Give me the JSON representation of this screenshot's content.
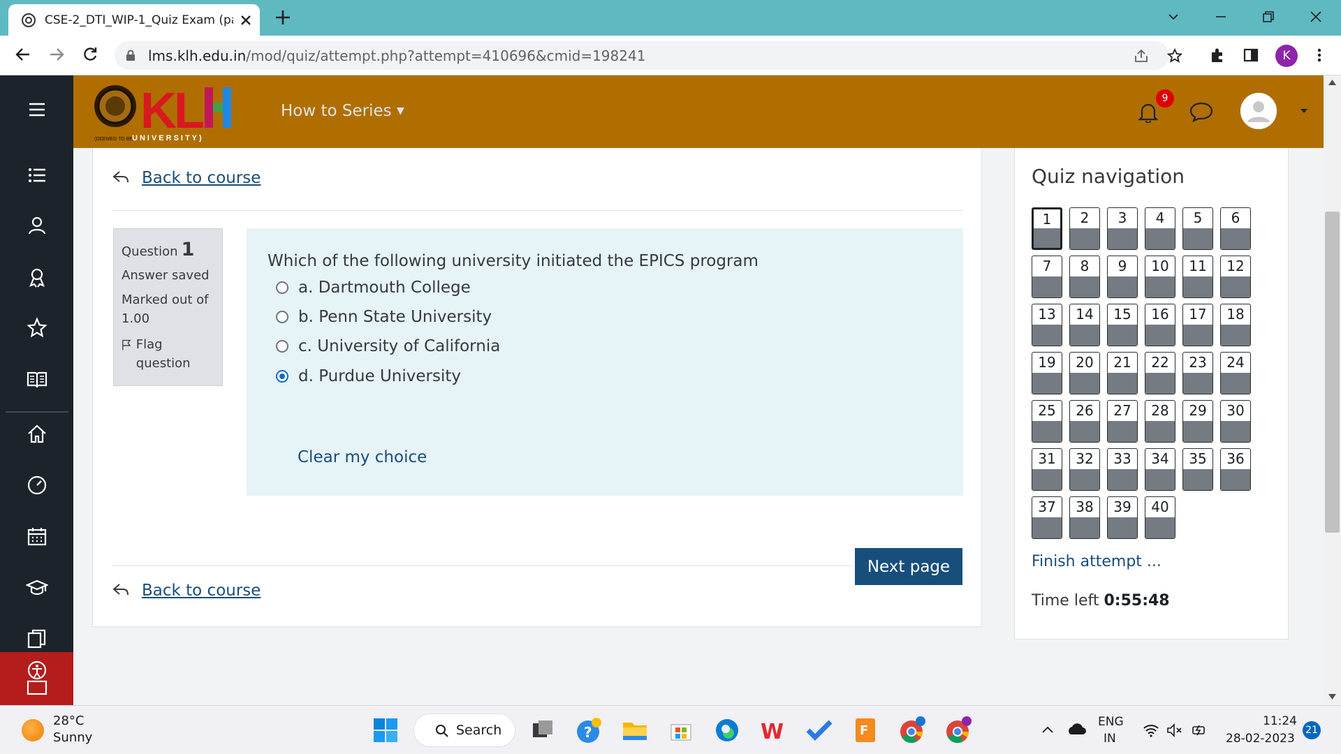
{
  "browser": {
    "tab_title": "CSE-2_DTI_WIP-1_Quiz Exam (pa",
    "url_host": "lms.klh.edu.in",
    "url_path": "/mod/quiz/attempt.php?attempt=410696&cmid=198241",
    "profile_initial": "K"
  },
  "header": {
    "logo_text": "KLH",
    "logo_sub": "(DEEMED TO BE UNIVERSITY)",
    "menu_label": "How to Series",
    "notification_count": "9"
  },
  "page": {
    "back_link": "Back to course",
    "next_button": "Next page"
  },
  "question": {
    "label": "Question",
    "number": "1",
    "status": "Answer saved",
    "marked": "Marked out of 1.00",
    "flag": "Flag question",
    "text": "Which of the following university initiated the EPICS program",
    "options": [
      {
        "label": "a. Dartmouth College",
        "checked": false
      },
      {
        "label": "b. Penn State University",
        "checked": false
      },
      {
        "label": "c. University of California",
        "checked": false
      },
      {
        "label": "d. Purdue University",
        "checked": true
      }
    ],
    "clear_choice": "Clear my choice"
  },
  "quiz_nav": {
    "title": "Quiz navigation",
    "questions": [
      "1",
      "2",
      "3",
      "4",
      "5",
      "6",
      "7",
      "8",
      "9",
      "10",
      "11",
      "12",
      "13",
      "14",
      "15",
      "16",
      "17",
      "18",
      "19",
      "20",
      "21",
      "22",
      "23",
      "24",
      "25",
      "26",
      "27",
      "28",
      "29",
      "30",
      "31",
      "32",
      "33",
      "34",
      "35",
      "36",
      "37",
      "38",
      "39",
      "40"
    ],
    "current": "1",
    "finish": "Finish attempt ...",
    "time_label": "Time left",
    "time_value": "0:55:48"
  },
  "taskbar": {
    "temperature": "28°C",
    "weather": "Sunny",
    "search": "Search",
    "lang_top": "ENG",
    "lang_bottom": "IN",
    "time": "11:24",
    "date": "28-02-2023",
    "notifications": "21"
  },
  "colors": {
    "tab_strip": "#5fb9c1",
    "header": "#b06e00",
    "rail": "#1d232b",
    "question_bg": "#e6f3f7",
    "primary_button": "#174e7c",
    "link": "#1a4d7a"
  }
}
